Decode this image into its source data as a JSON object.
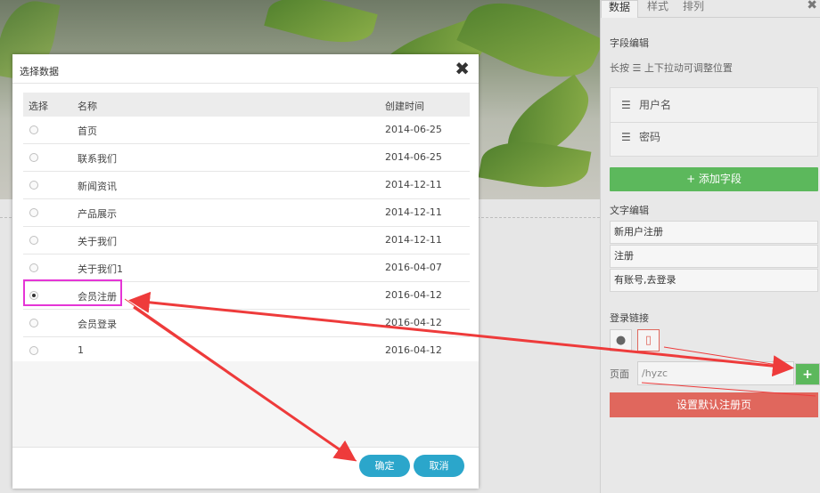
{
  "panel": {
    "tabs": [
      {
        "label": "数据",
        "active": true
      },
      {
        "label": "样式",
        "active": false
      },
      {
        "label": "排列",
        "active": false
      }
    ],
    "close_icon": "close-icon",
    "field_section_title": "字段编辑",
    "hint": "长按 ☰ 上下拉动可调整位置",
    "fields": [
      "用户名",
      "密码"
    ],
    "add_field_label": "+ 添加字段",
    "text_section_title": "文字编辑",
    "text_items": [
      "新用户注册",
      "注册",
      "有账号,去登录"
    ],
    "login_link_title": "登录链接",
    "link_icons": [
      "globe-icon",
      "page-icon"
    ],
    "page_label": "页面",
    "page_value": "/hyzc",
    "page_add_label": "+",
    "set_default_label": "设置默认注册页"
  },
  "modal": {
    "title": "选择数据",
    "close_label": "✖",
    "columns": [
      "选择",
      "名称",
      "创建时间"
    ],
    "rows": [
      {
        "name": "首页",
        "date": "2014-06-25",
        "selected": false
      },
      {
        "name": "联系我们",
        "date": "2014-06-25",
        "selected": false
      },
      {
        "name": "新闻资讯",
        "date": "2014-12-11",
        "selected": false
      },
      {
        "name": "产品展示",
        "date": "2014-12-11",
        "selected": false
      },
      {
        "name": "关于我们",
        "date": "2014-12-11",
        "selected": false
      },
      {
        "name": "关于我们1",
        "date": "2016-04-07",
        "selected": false
      },
      {
        "name": "会员注册",
        "date": "2016-04-12",
        "selected": true
      },
      {
        "name": "会员登录",
        "date": "2016-04-12",
        "selected": false
      },
      {
        "name": "1",
        "date": "2016-04-12",
        "selected": false
      }
    ],
    "confirm_label": "确定",
    "cancel_label": "取消"
  },
  "colors": {
    "green": "#5cb85c",
    "red": "#e0675d",
    "blue": "#2ba6cb",
    "annotation_red": "#ee3b3b",
    "highlight_magenta": "#e535d6"
  }
}
